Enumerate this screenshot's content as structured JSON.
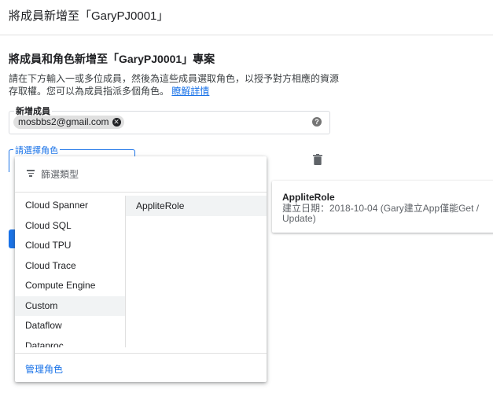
{
  "header": {
    "title": "將成員新增至「GaryPJ0001」"
  },
  "section": {
    "title": "將成員和角色新增至「GaryPJ0001」專案",
    "description": "請在下方輸入一或多位成員，然後為這些成員選取角色，以授予對方相應的資源存取權。您可以為成員指派多個角色。",
    "learn_more": "瞭解詳情"
  },
  "members": {
    "label": "新增成員",
    "chips": [
      "mosbbs2@gmail.com"
    ],
    "help_icon": "help-icon"
  },
  "role_select": {
    "label": "請選擇角色",
    "delete_icon": "trash-icon"
  },
  "dropdown": {
    "filter_placeholder": "篩選類型",
    "filter_icon": "filter-icon",
    "categories": [
      "Cloud Spanner",
      "Cloud SQL",
      "Cloud TPU",
      "Cloud Trace",
      "Compute Engine",
      "Custom",
      "Dataflow",
      "Dataproc"
    ],
    "selected_category": "Custom",
    "roles": [
      "AppliteRole"
    ],
    "manage_link": "管理角色"
  },
  "role_detail": {
    "name": "AppliteRole",
    "description": "建立日期：2018-10-04 (Gary建立App僅能Get / Update)"
  },
  "colors": {
    "accent": "#1a73e8",
    "text": "#202124",
    "secondary_text": "#5f6368",
    "chip_bg": "#e0e0e0",
    "selected_bg": "#f1f3f4"
  }
}
